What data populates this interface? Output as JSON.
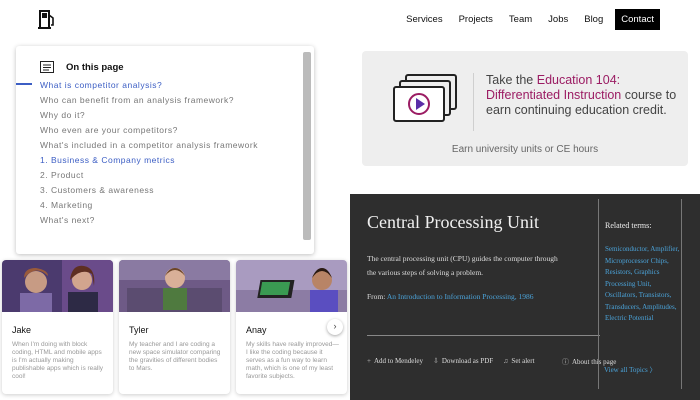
{
  "nav": {
    "items": [
      "Services",
      "Projects",
      "Team",
      "Jobs",
      "Blog"
    ],
    "contact": "Contact"
  },
  "toc": {
    "title": "On this page",
    "items": [
      "What is competitor analysis?",
      "Who can benefit from an analysis framework?",
      "Why do it?",
      "Who even are your competitors?",
      "What's included in a competitor analysis framework",
      "1. Business & Company metrics",
      "2. Product",
      "3. Customers & awareness",
      "4. Marketing",
      "What's next?"
    ]
  },
  "promo": {
    "line1": "Take the ",
    "highlight": "Education 104: Differentiated Instruction",
    "line2": " course to earn continuing education credit.",
    "footer": "Earn university units or CE hours"
  },
  "cpu": {
    "title": "Central Processing Unit",
    "description": "The central processing unit (CPU) guides the computer through the various steps of solving a problem.",
    "from_label": "From: ",
    "from_link": "An Introduction to Information Processing, 1986",
    "actions": [
      "Add to Mendeley",
      "Download as PDF",
      "Set alert"
    ],
    "about": "About this page",
    "related_title": "Related terms:",
    "related_terms": "Semiconductor, Amplifier, Microprocessor Chips, Resistors, Graphics Processing Unit, Oscillators, Transistors, Transducers, Amplitudes, Electric Potential",
    "view_all": "View all Topics"
  },
  "cards": [
    {
      "name": "Jake",
      "quote": "When I'm doing with block coding, HTML and mobile apps is I'm actually making publishable apps which is really cool!"
    },
    {
      "name": "Tyler",
      "quote": "My teacher and I are coding a new space simulator comparing the gravities of different bodies to Mars."
    },
    {
      "name": "Anay",
      "quote": "My skills have really improved—I like the coding because it serves as a fun way to learn math, which is one of my least favorite subjects."
    }
  ],
  "colors": {
    "accent_blue": "#3c5ec4",
    "promo_highlight": "#9b1c63",
    "link_blue": "#4ba3d9",
    "dark_panel": "#2e2e2e"
  }
}
